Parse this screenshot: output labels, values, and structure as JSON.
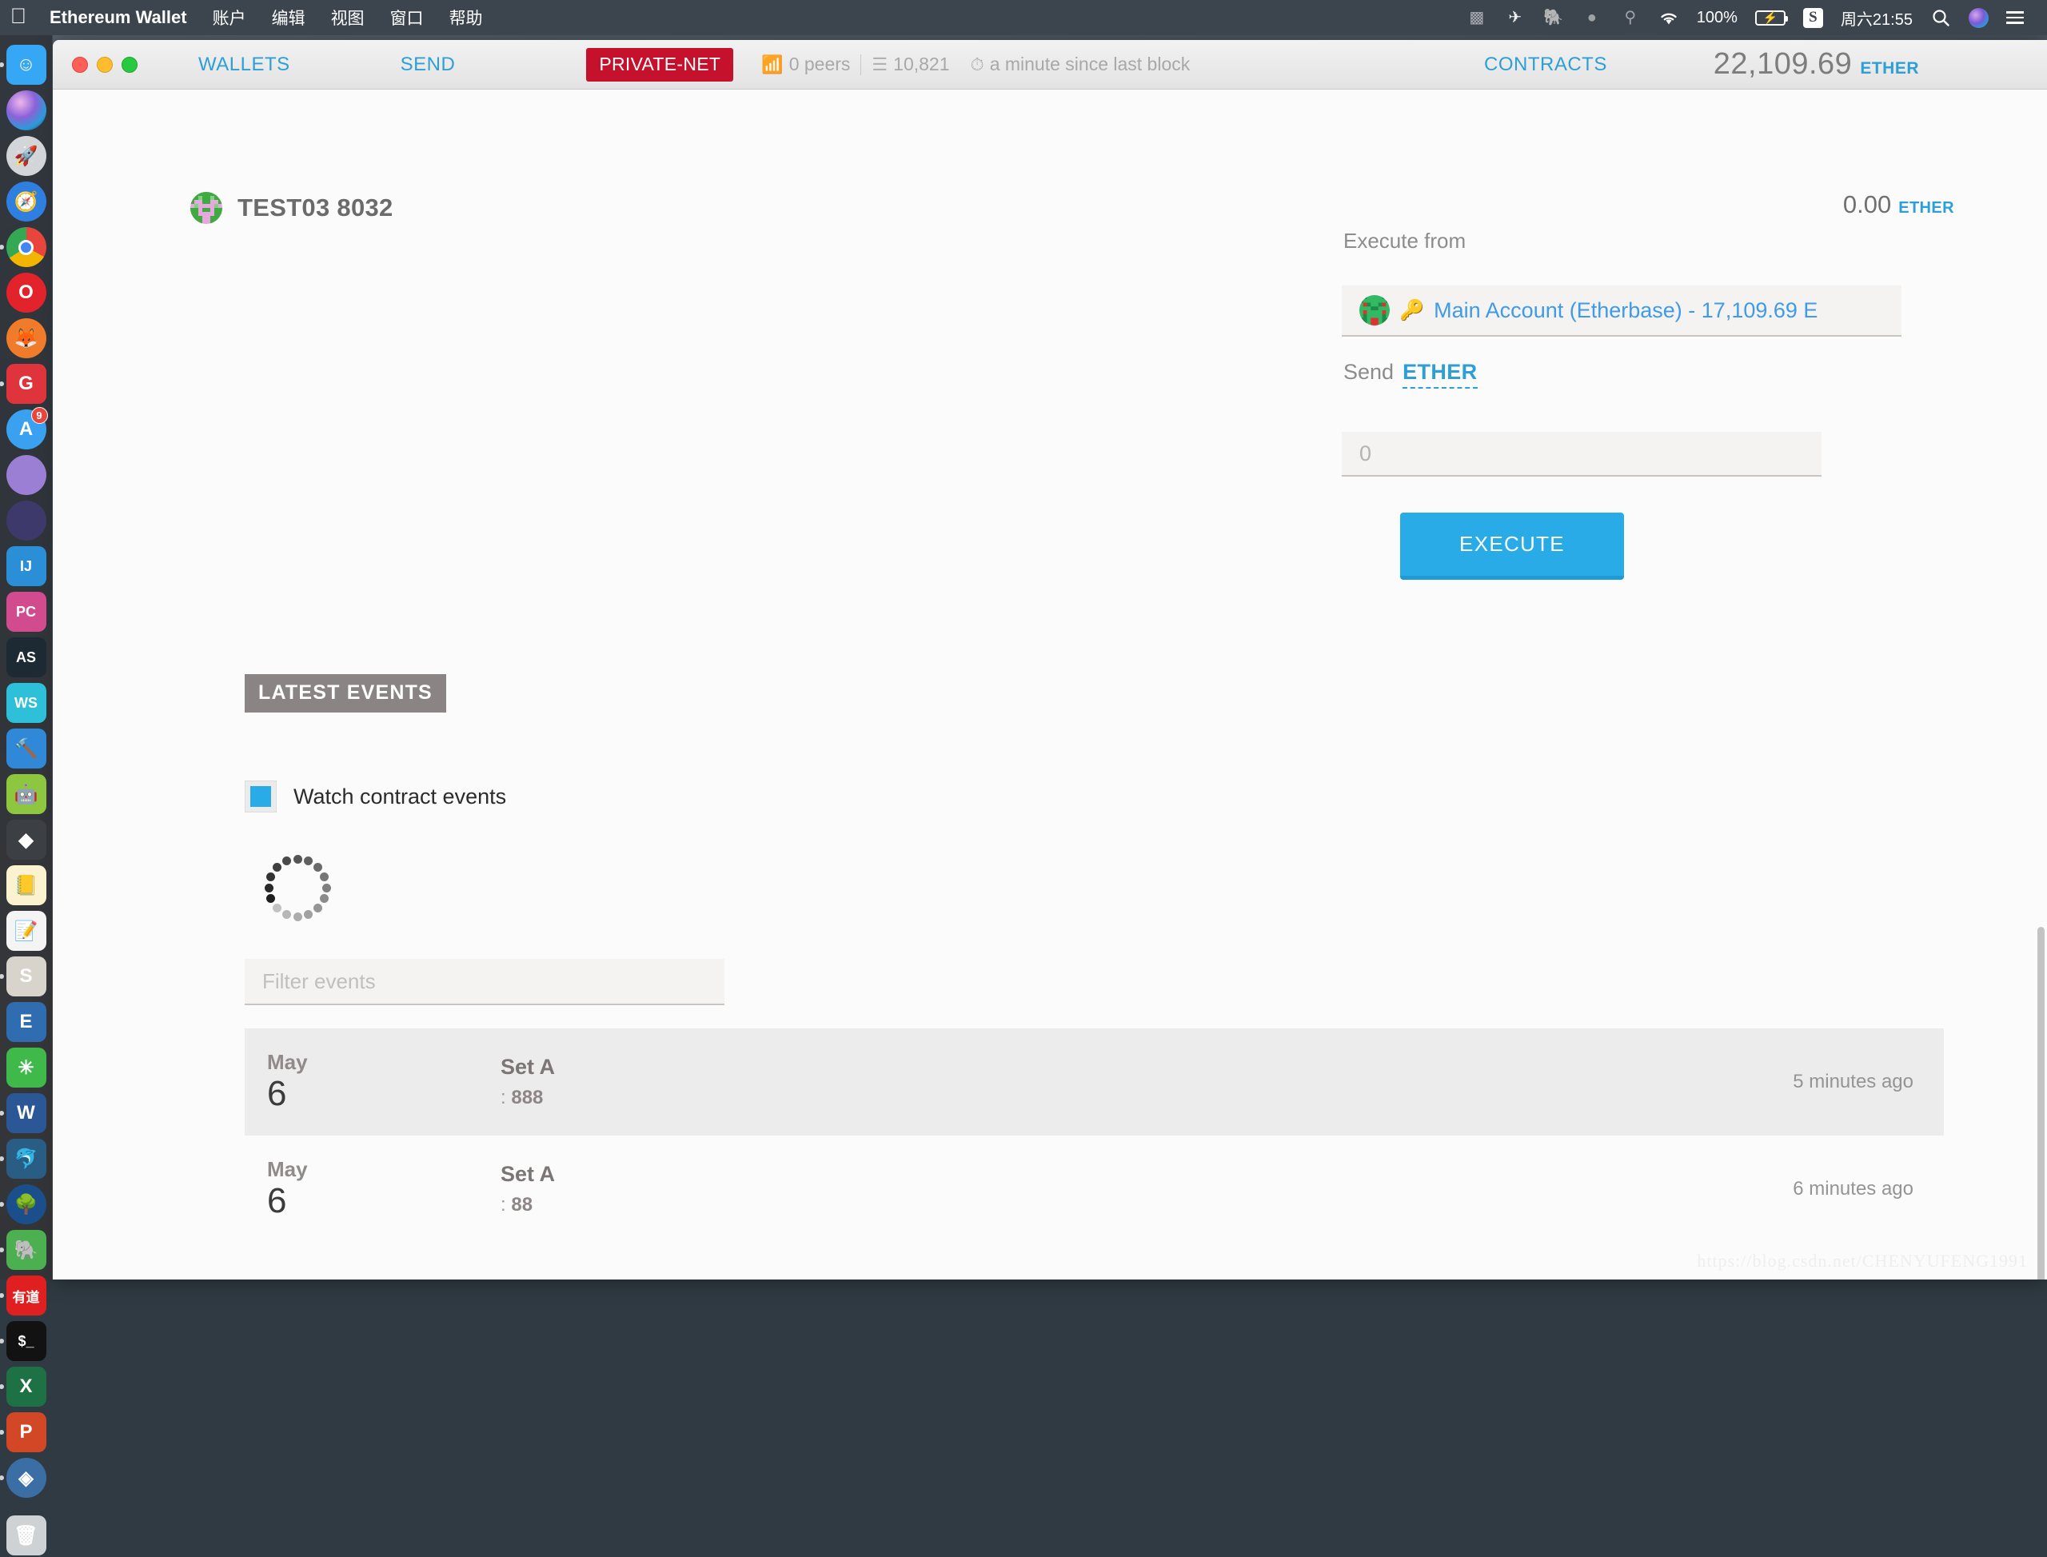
{
  "menubar": {
    "apple_icon": "apple-logo",
    "app_name": "Ethereum Wallet",
    "menus": [
      "账户",
      "编辑",
      "视图",
      "窗口",
      "帮助"
    ],
    "status": {
      "icons": [
        "grammarly-icon",
        "telegram-icon",
        "evernote-icon",
        "bartender-icon",
        "search-app-icon",
        "wifi-icon"
      ],
      "battery_percent": "100%",
      "battery_icon": "battery-charging-icon",
      "input_method": "S",
      "clock": "周六21:55",
      "spotlight_icon": "search-icon",
      "siri_icon": "siri-icon",
      "notification_icon": "notification-center-icon"
    }
  },
  "dock": {
    "items": [
      {
        "name": "finder",
        "glyph": "☺",
        "bg": "#36a7f5",
        "running": true,
        "shape": "rect"
      },
      {
        "name": "siri",
        "glyph": "",
        "bg": "siri",
        "running": false,
        "shape": "circle"
      },
      {
        "name": "launchpad",
        "glyph": "🚀",
        "bg": "#d3d6d9",
        "running": false,
        "shape": "circle"
      },
      {
        "name": "safari",
        "glyph": "🧭",
        "bg": "#2f7fe0",
        "running": false,
        "shape": "circle"
      },
      {
        "name": "google-chrome",
        "glyph": "",
        "bg": "chrome",
        "running": true,
        "shape": "circle"
      },
      {
        "name": "opera",
        "glyph": "O",
        "bg": "#e2232b",
        "running": false,
        "shape": "circle"
      },
      {
        "name": "firefox",
        "glyph": "🦊",
        "bg": "#f07b2a",
        "running": false,
        "shape": "circle"
      },
      {
        "name": "g-app",
        "glyph": "G",
        "bg": "#e0343d",
        "running": true,
        "shape": "rect"
      },
      {
        "name": "app-store",
        "glyph": "A",
        "bg": "#3aa0f0",
        "running": false,
        "shape": "circle",
        "badge": "9"
      },
      {
        "name": "purple-disc-app",
        "glyph": "",
        "bg": "#9b7fd4",
        "running": false,
        "shape": "circle"
      },
      {
        "name": "dark-disc-app",
        "glyph": "",
        "bg": "#3d3a6b",
        "running": false,
        "shape": "circle"
      },
      {
        "name": "intellij-idea",
        "glyph": "IJ",
        "bg": "#2b8fd8",
        "running": false,
        "shape": "rect"
      },
      {
        "name": "pycharm",
        "glyph": "PC",
        "bg": "#d24b8f",
        "running": false,
        "shape": "rect"
      },
      {
        "name": "android-studio",
        "glyph": "AS",
        "bg": "#1d2a33",
        "running": false,
        "shape": "rect"
      },
      {
        "name": "webstorm",
        "glyph": "WS",
        "bg": "#2ec0d8",
        "running": false,
        "shape": "rect"
      },
      {
        "name": "xcode",
        "glyph": "🔨",
        "bg": "#2f88d8",
        "running": false,
        "shape": "rect"
      },
      {
        "name": "android",
        "glyph": "🤖",
        "bg": "#8dc63f",
        "running": false,
        "shape": "rect"
      },
      {
        "name": "mist-ethereum",
        "glyph": "◆",
        "bg": "#3c4045",
        "running": false,
        "shape": "rect"
      },
      {
        "name": "notes",
        "glyph": "📒",
        "bg": "#fbf3d0",
        "running": false,
        "shape": "rect"
      },
      {
        "name": "text-editor",
        "glyph": "📝",
        "bg": "#f4f4f4",
        "running": false,
        "shape": "rect"
      },
      {
        "name": "sublime-text",
        "glyph": "S",
        "bg": "#d8d4cc",
        "running": true,
        "shape": "rect"
      },
      {
        "name": "keynote-like-app",
        "glyph": "E",
        "bg": "#2f6cb0",
        "running": false,
        "shape": "rect"
      },
      {
        "name": "omnigraffle",
        "glyph": "✳",
        "bg": "#3fb94a",
        "running": false,
        "shape": "rect"
      },
      {
        "name": "microsoft-word",
        "glyph": "W",
        "bg": "#2b5797",
        "running": true,
        "shape": "rect"
      },
      {
        "name": "mysql-workbench",
        "glyph": "🐬",
        "bg": "#2a5d84",
        "running": true,
        "shape": "rect"
      },
      {
        "name": "navicat",
        "glyph": "🌳",
        "bg": "#1b4f8c",
        "running": true,
        "shape": "circle"
      },
      {
        "name": "evernote",
        "glyph": "🐘",
        "bg": "#4caf50",
        "running": true,
        "shape": "rect"
      },
      {
        "name": "youdao-dict",
        "glyph": "有道",
        "bg": "#e02020",
        "running": true,
        "shape": "rect"
      },
      {
        "name": "terminal",
        "glyph": "$_",
        "bg": "#121212",
        "running": true,
        "shape": "rect"
      },
      {
        "name": "microsoft-excel",
        "glyph": "X",
        "bg": "#1e7145",
        "running": true,
        "shape": "rect"
      },
      {
        "name": "microsoft-powerpoint",
        "glyph": "P",
        "bg": "#d24726",
        "running": true,
        "shape": "rect"
      },
      {
        "name": "ethereum-wallet",
        "glyph": "◈",
        "bg": "#3a6ea5",
        "running": true,
        "shape": "circle"
      },
      {
        "name": "trash",
        "glyph": "🗑",
        "bg": "#cfd2d5",
        "running": false,
        "shape": "rect"
      }
    ]
  },
  "toolbar": {
    "window_controls": [
      "close",
      "minimize",
      "zoom"
    ],
    "nav": {
      "wallets": "WALLETS",
      "send": "SEND",
      "contracts": "CONTRACTS"
    },
    "network_badge": "PRIVATE-NET",
    "network_badge_color": "#c5112b",
    "peers": "0 peers",
    "block_number": "10,821",
    "last_block": "a minute since last block",
    "balance_amount": "22,109.69",
    "balance_unit": "ETHER",
    "accent_color": "#2e9fd6"
  },
  "contract": {
    "name": "TEST03 8032",
    "balance_amount": "0.00",
    "balance_unit": "ETHER"
  },
  "execute": {
    "from_label": "Execute from",
    "account_option": "Main Account (Etherbase) - 17,109.69 E",
    "key_icon": "key-icon",
    "send_label": "Send",
    "send_unit": "ETHER",
    "amount_placeholder": "0",
    "amount_value": "",
    "button_label": "EXECUTE",
    "button_color": "#29abe8"
  },
  "events": {
    "section_title": "LATEST EVENTS",
    "watch_label": "Watch contract events",
    "watch_checked": true,
    "loading_spinner": "loading-spinner",
    "filter_placeholder": "Filter events",
    "filter_value": "",
    "rows": [
      {
        "month": "May",
        "day": "6",
        "name": "Set A",
        "args_colon": ":",
        "args_value": "888",
        "time": "5 minutes ago"
      },
      {
        "month": "May",
        "day": "6",
        "name": "Set A",
        "args_colon": ":",
        "args_value": "88",
        "time": "6 minutes ago"
      }
    ]
  },
  "watermark": "https://blog.csdn.net/CHENYUFENG1991"
}
